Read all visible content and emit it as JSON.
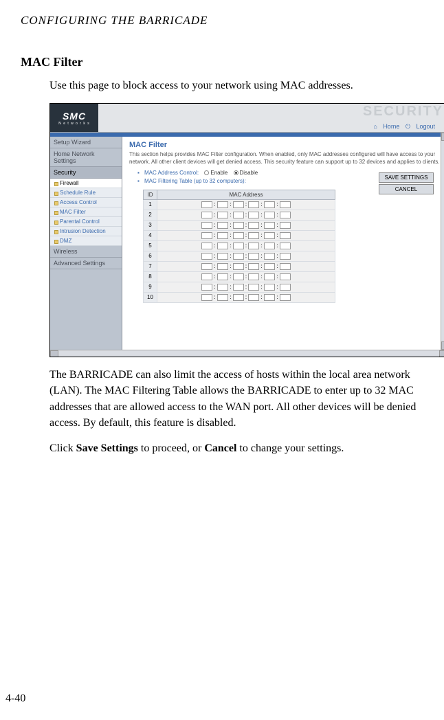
{
  "header_line": "CONFIGURING THE BARRICADE",
  "section_title": "MAC Filter",
  "intro": "Use this page to block access to your network using MAC addresses.",
  "para2": "The BARRICADE can also limit the access of hosts within the local area network (LAN). The MAC Filtering Table allows the BARRICADE to enter up to 32 MAC addresses that are allowed access to the WAN port. All other devices will be denied access. By default, this feature is disabled.",
  "para3_pre": "Click ",
  "para3_b1": "Save Settings",
  "para3_mid": " to proceed, or ",
  "para3_b2": "Cancel",
  "para3_post": " to change your settings.",
  "page_number": "4-40",
  "screenshot": {
    "logo": "SMC",
    "logo_sub": "N e t w o r k s",
    "banner": "SECURITY",
    "nav_home": "Home",
    "nav_logout": "Logout",
    "sidebar": {
      "items": [
        "Setup Wizard",
        "Home Network Settings",
        "Security",
        "Wireless",
        "Advanced Settings"
      ],
      "subs": [
        "Firewall",
        "Schedule Rule",
        "Access Control",
        "MAC Filter",
        "Parental Control",
        "Intrusion Detection",
        "DMZ"
      ]
    },
    "panel_title": "MAC Filter",
    "panel_desc": "This section helps provides MAC Filter configuration. When enabled, only MAC addresses configured will have access to your network. All other client devices will get denied access. This security feature can support up to 32 devices and applies to clients.",
    "bullet1_label": "MAC Address Control:",
    "radio_enable": "Enable",
    "radio_disable": "Disable",
    "bullet2": "MAC Filtering Table (up to 32 computers):",
    "btn_save": "SAVE SETTINGS",
    "btn_cancel": "CANCEL",
    "table": {
      "col_id": "ID",
      "col_mac": "MAC Address",
      "rows": [
        1,
        2,
        3,
        4,
        5,
        6,
        7,
        8,
        9,
        10
      ]
    }
  }
}
